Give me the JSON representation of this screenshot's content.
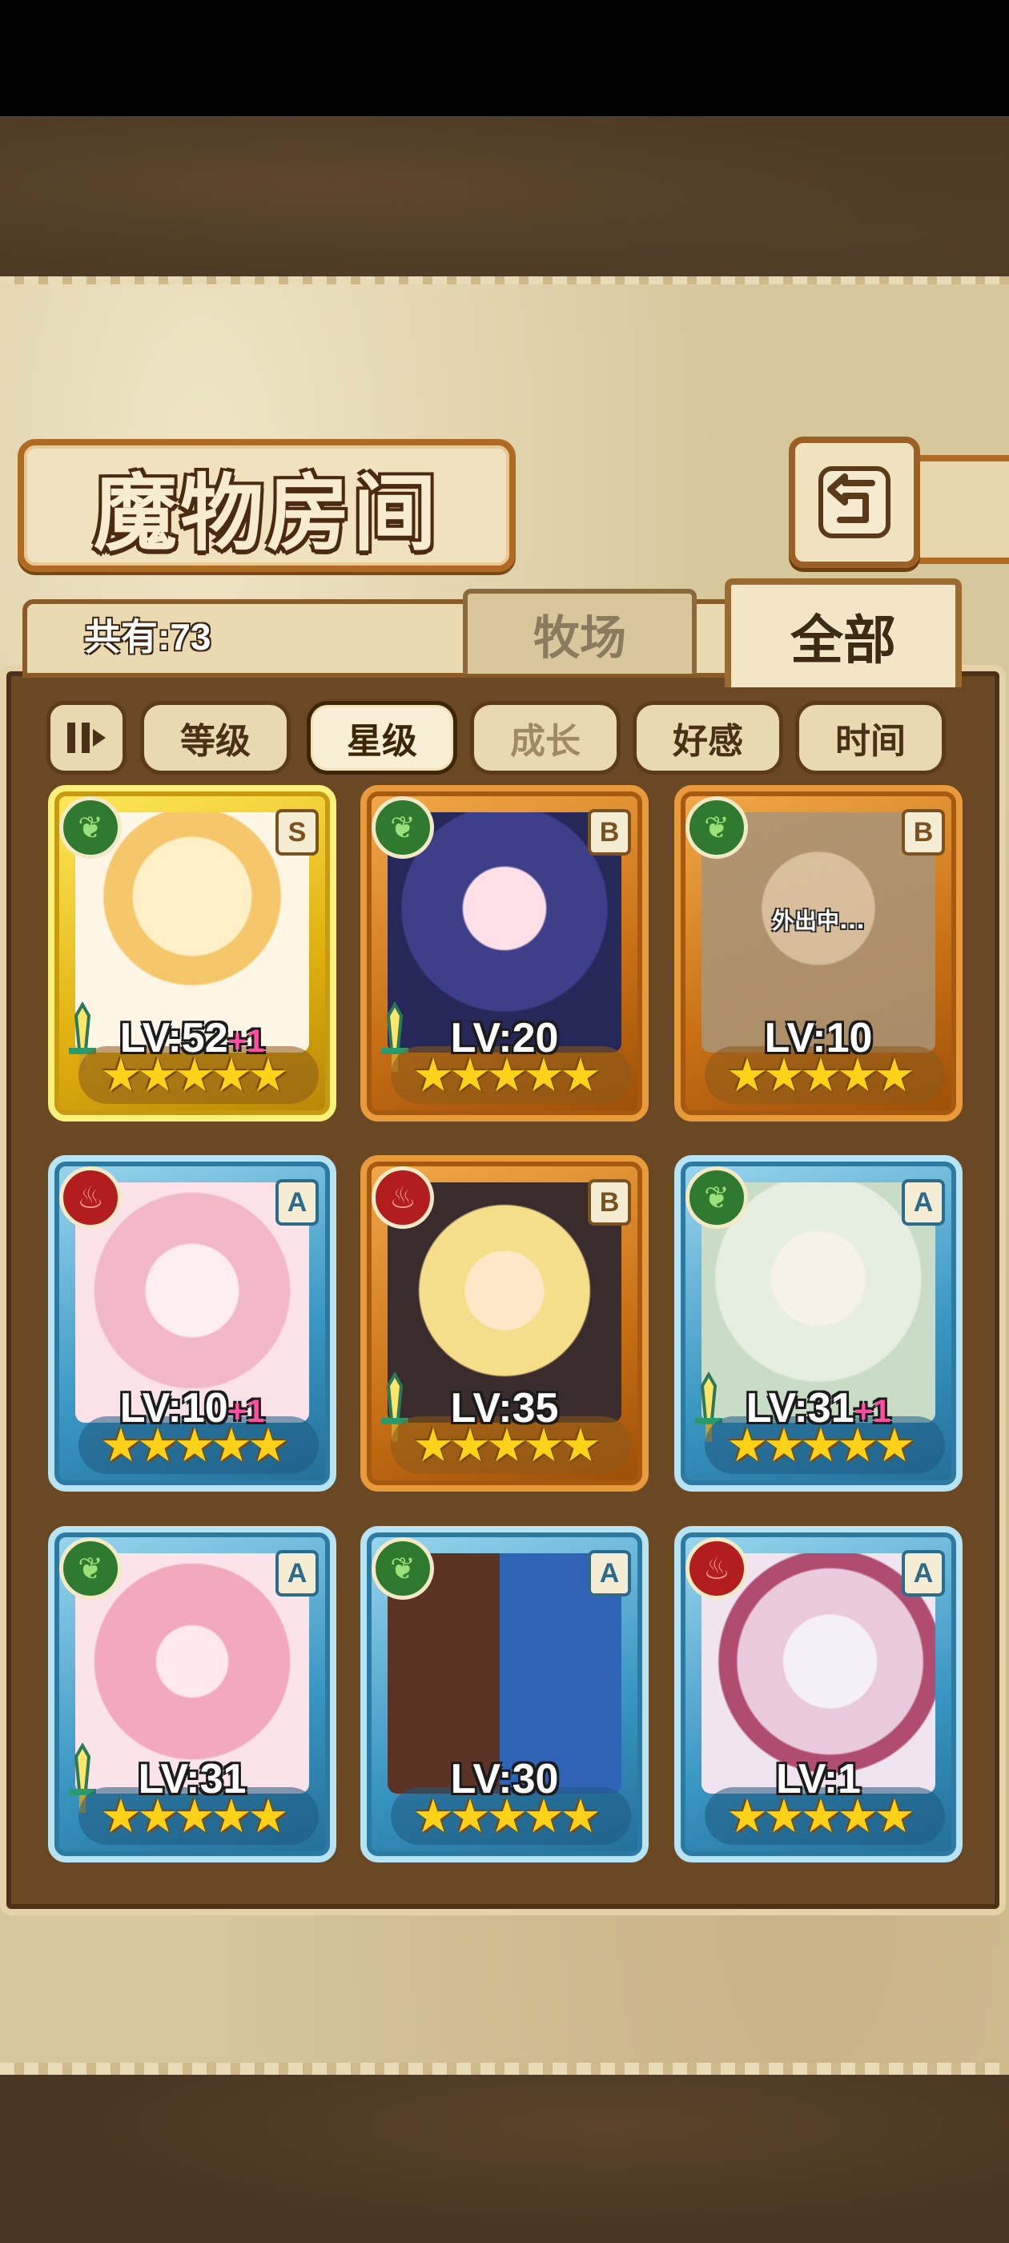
{
  "title": "魔物房间",
  "count": {
    "label": "共有:73"
  },
  "tabs": [
    {
      "label": "牧场",
      "selected": false
    },
    {
      "label": "全部",
      "selected": true
    }
  ],
  "sort_buttons": [
    {
      "label": "等级",
      "active": false
    },
    {
      "label": "星级",
      "active": true
    },
    {
      "label": "成长",
      "active": false
    },
    {
      "label": "好感",
      "active": false
    },
    {
      "label": "时间",
      "active": false
    }
  ],
  "colors": {
    "gold_frame": "#e0b10f",
    "orange_frame": "#c86f14",
    "blue_frame": "#3a96c3",
    "grass_element": "#2f7a2e",
    "fire_element": "#b21d1d",
    "bonus_text": "#ff4fa0"
  },
  "monsters": [
    {
      "level": "LV:52",
      "bonus": "+1",
      "rank": "S",
      "element": "grass",
      "element_icon": "leaf-icon",
      "stars": "★★★★★",
      "star_count": 5,
      "frame": "gold",
      "weapon": true,
      "status": ""
    },
    {
      "level": "LV:20",
      "bonus": "",
      "rank": "B",
      "element": "grass",
      "element_icon": "leaf-icon",
      "stars": "★★★★★",
      "star_count": 5,
      "frame": "orange",
      "weapon": true,
      "status": ""
    },
    {
      "level": "LV:10",
      "bonus": "",
      "rank": "B",
      "element": "grass",
      "element_icon": "leaf-icon",
      "stars": "★★★★★",
      "star_count": 5,
      "frame": "orange",
      "weapon": false,
      "status": "外出中..."
    },
    {
      "level": "LV:10",
      "bonus": "+1",
      "rank": "A",
      "element": "fire",
      "element_icon": "flame-icon",
      "stars": "★★★★★",
      "star_count": 5,
      "frame": "blue",
      "weapon": false,
      "status": ""
    },
    {
      "level": "LV:35",
      "bonus": "",
      "rank": "B",
      "element": "fire",
      "element_icon": "flame-icon",
      "stars": "★★★★★",
      "star_count": 5,
      "frame": "orange",
      "weapon": true,
      "status": ""
    },
    {
      "level": "LV:31",
      "bonus": "+1",
      "rank": "A",
      "element": "grass",
      "element_icon": "leaf-icon",
      "stars": "★★★★★",
      "star_count": 5,
      "frame": "blue",
      "weapon": true,
      "status": ""
    },
    {
      "level": "LV:31",
      "bonus": "",
      "rank": "A",
      "element": "grass",
      "element_icon": "leaf-icon",
      "stars": "★★★★★",
      "star_count": 5,
      "frame": "blue",
      "weapon": true,
      "status": ""
    },
    {
      "level": "LV:30",
      "bonus": "",
      "rank": "A",
      "element": "grass",
      "element_icon": "leaf-icon",
      "stars": "★★★★★",
      "star_count": 5,
      "frame": "blue",
      "weapon": false,
      "status": ""
    },
    {
      "level": "LV:1",
      "bonus": "",
      "rank": "A",
      "element": "fire",
      "element_icon": "flame-icon",
      "stars": "★★★★★",
      "star_count": 5,
      "frame": "blue",
      "weapon": false,
      "status": ""
    }
  ]
}
